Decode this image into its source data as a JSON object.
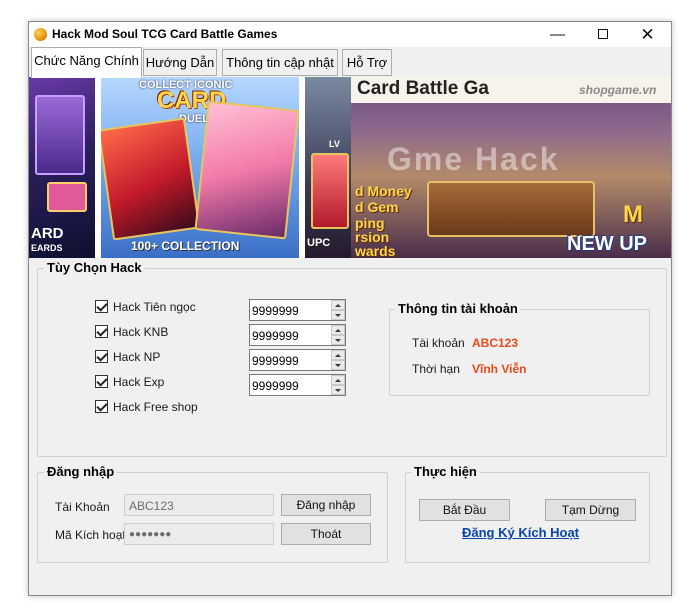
{
  "window": {
    "title": "Hack Mod Soul TCG Card Battle Games",
    "minimize": "—",
    "close": "✕"
  },
  "tabs": [
    {
      "label": "Chức Năng Chính",
      "active": true
    },
    {
      "label": "Hướng Dẫn",
      "active": false
    },
    {
      "label": "Thông tin cập nhật",
      "active": false
    },
    {
      "label": "Hỗ Trợ",
      "active": false
    }
  ],
  "banner": {
    "panel1": {
      "line1": "ARD",
      "line2": "EARDS"
    },
    "panel2": {
      "top": "COLLECT ICONIC",
      "main": "CARD",
      "sub": "DUEL",
      "bottom": "100+ COLLECTION"
    },
    "panel3": {
      "top": "LV",
      "bottom": "UPC"
    },
    "panel4": {
      "title": "Card Battle Ga",
      "watermark": "shopgame.vn",
      "overlay": "Gme Hack",
      "lines": [
        "d Money",
        "d Gem",
        "ping",
        "rsion",
        "wards"
      ],
      "ma": "M",
      "new": "NEW UP"
    }
  },
  "hack_options": {
    "title": "Tùy Chọn Hack",
    "items": [
      {
        "label": "Hack Tiên ngọc",
        "checked": true,
        "value": "9999999"
      },
      {
        "label": "Hack KNB",
        "checked": true,
        "value": "9999999"
      },
      {
        "label": "Hack NP",
        "checked": true,
        "value": "9999999"
      },
      {
        "label": "Hack Exp",
        "checked": true,
        "value": "9999999"
      },
      {
        "label": "Hack Free shop",
        "checked": true
      }
    ]
  },
  "account_info": {
    "title": "Thông tin tài khoản",
    "account_label": "Tài khoản",
    "account_value": "ABC123",
    "duration_label": "Thời hạn",
    "duration_value": "Vĩnh Viễn"
  },
  "login": {
    "title": "Đăng nhập",
    "account_label": "Tài Khoản",
    "account_value": "ABC123",
    "code_label": "Mã Kích hoạt",
    "code_value": "●●●●●●●",
    "login_button": "Đăng nhập",
    "exit_button": "Thoát"
  },
  "actions": {
    "title": "Thực hiện",
    "start_button": "Bắt Đầu",
    "pause_button": "Tạm Dừng",
    "register_link": "Đăng Ký Kích Hoạt"
  },
  "colors": {
    "accent_red": "#e84a1a",
    "link_blue": "#0645ad"
  }
}
